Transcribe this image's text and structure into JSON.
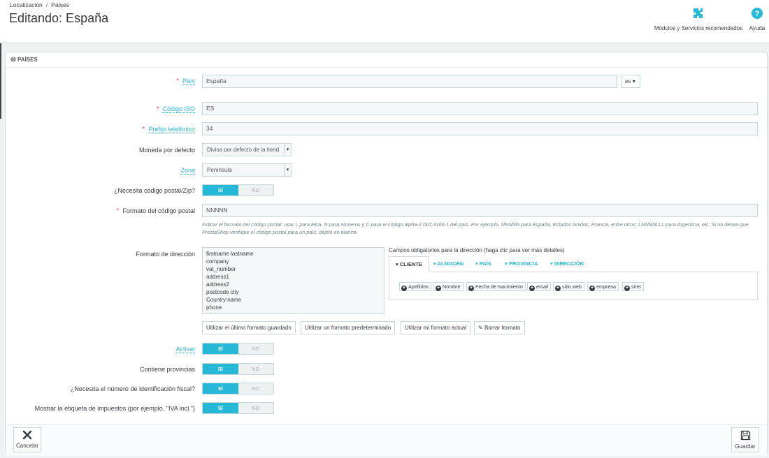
{
  "breadcrumb": {
    "parent": "Localización",
    "separator": "/",
    "current": "Países"
  },
  "page_title": "Editando: España",
  "toolbar": {
    "modules_label": "Módulos y Servicios recomendados",
    "help_label": "Ayuda"
  },
  "panel": {
    "heading": "PAÍSES"
  },
  "form": {
    "country": {
      "label": "País",
      "value": "España",
      "lang": "es"
    },
    "iso": {
      "label": "Código ISO",
      "value": "ES"
    },
    "phone_prefix": {
      "label": "Prefijo telefónico",
      "value": "34"
    },
    "currency": {
      "label": "Moneda por defecto",
      "value": "Divisa por defecto de la tiend"
    },
    "zone": {
      "label": "Zona",
      "value": "Península"
    },
    "need_zip": {
      "label": "¿Necesita código postal/Zip?",
      "on": "SÍ",
      "off": "NO"
    },
    "zip_format": {
      "label": "Formato del código postal",
      "value": "NNNNN",
      "help": "Indicar el formato del código postal: usar L para letra, N para números y C para el código alpha-2 ISO 3166-1 del país. Por ejemplo, NNNNN para España, Estados Unidos, Francia, entre otros; LNNNNLLL para Argentina, etc. Si no desea que PrestaShop verifique el código postal para un país, déjelo en blanco."
    },
    "address_format": {
      "label": "Formato de dirección",
      "lines": [
        "firstname lastname",
        "company",
        "vat_number",
        "address1",
        "address2",
        "postcode city",
        "Country:name",
        "phone"
      ]
    },
    "required_fields": {
      "title": "Campos obligatorios para la dirección (haga clic para ver más detalles)",
      "tabs": [
        "CLIENTE",
        "ALMACÉN",
        "PAÍS",
        "PROVINCIA",
        "DIRECCIÓN"
      ],
      "chips": [
        "Apellidos",
        "Nombre",
        "Fecha de Nacimiento",
        "email",
        "sitio web",
        "empresa",
        "siret"
      ]
    },
    "format_buttons": {
      "last_saved": "Utilizar el último formato guardado",
      "default": "Utilizar un formato predeterminado",
      "current": "Utilizar mi formato actual",
      "clear": "Borrar formato"
    },
    "active": {
      "label": "Activar",
      "on": "SÍ",
      "off": "NO"
    },
    "contains_states": {
      "label": "Contiene provincias",
      "on": "SÍ",
      "off": "NO"
    },
    "need_tax_id": {
      "label": "¿Necesita el número de identificación fiscal?",
      "on": "SÍ",
      "off": "NO"
    },
    "display_tax_label": {
      "label": "Mostrar la etiqueta de impuestos (por ejemplo, \"IVA incl.\")",
      "on": "SÍ",
      "off": "NO"
    }
  },
  "footer": {
    "cancel": "Cancelar",
    "save": "Guardar"
  },
  "colors": {
    "accent": "#25b9d7",
    "required": "#e84e6a",
    "text": "#363a41"
  }
}
